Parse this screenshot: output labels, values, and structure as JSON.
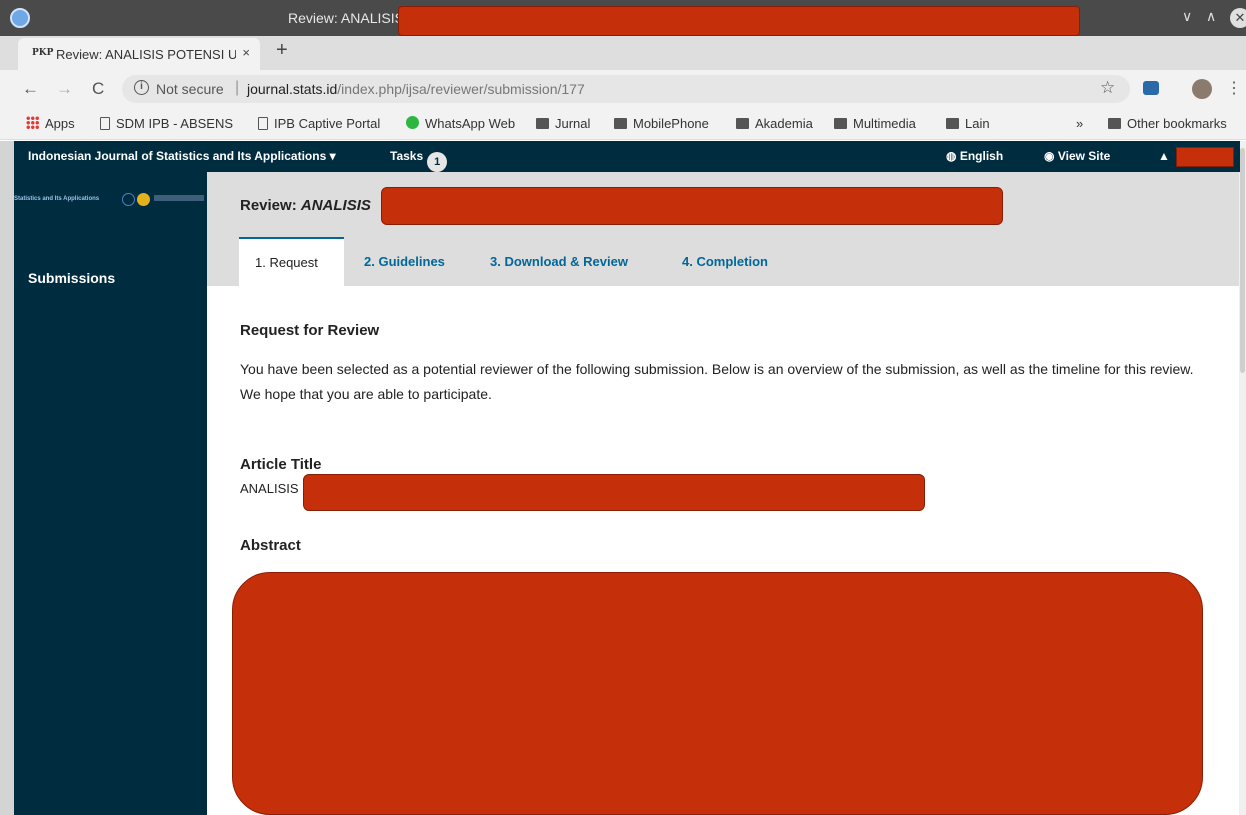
{
  "window": {
    "title": "Review: ANALISIS"
  },
  "browser": {
    "tab_favicon": "PKP",
    "tab_title": "Review: ANALISIS POTENSI U",
    "tab_close": "×",
    "new_tab": "+",
    "back": "←",
    "forward": "→",
    "reload": "C",
    "not_secure": "Not secure",
    "url_domain": "journal.stats.id",
    "url_path": "/index.php/ijsa/reviewer/submission/177",
    "star": "☆",
    "menu": "⋮"
  },
  "bookmarks": {
    "apps": "Apps",
    "items": [
      "SDM IPB - ABSENS",
      "IPB Captive Portal",
      "WhatsApp Web",
      "Jurnal",
      "MobilePhone",
      "Akademia",
      "Multimedia",
      "Lain"
    ],
    "overflow": "»",
    "other": "Other bookmarks"
  },
  "header": {
    "journal_name": "Indonesian Journal of Statistics and Its Applications",
    "dropdown_caret": "▾",
    "tasks_label": "Tasks",
    "tasks_count": "1",
    "language": "English",
    "view_site": "View Site"
  },
  "sidebar": {
    "logo_text": "Statistics and Its Applications",
    "items": [
      "Submissions"
    ]
  },
  "main": {
    "title": "Review:",
    "title_italic": "ANALISIS",
    "tabs": [
      "1. Request",
      "2. Guidelines",
      "3. Download & Review",
      "4. Completion"
    ],
    "request_heading": "Request for Review",
    "request_text": "You have been selected as a potential reviewer of the following submission. Below is an overview of the submission, as well as the timeline for this review. We hope that you are able to participate.",
    "article_title_label": "Article Title",
    "article_title_value": "ANALISIS",
    "abstract_label": "Abstract"
  },
  "colors": {
    "header_bg": "#002c40",
    "link": "#006798",
    "redaction": "#c5300a"
  }
}
